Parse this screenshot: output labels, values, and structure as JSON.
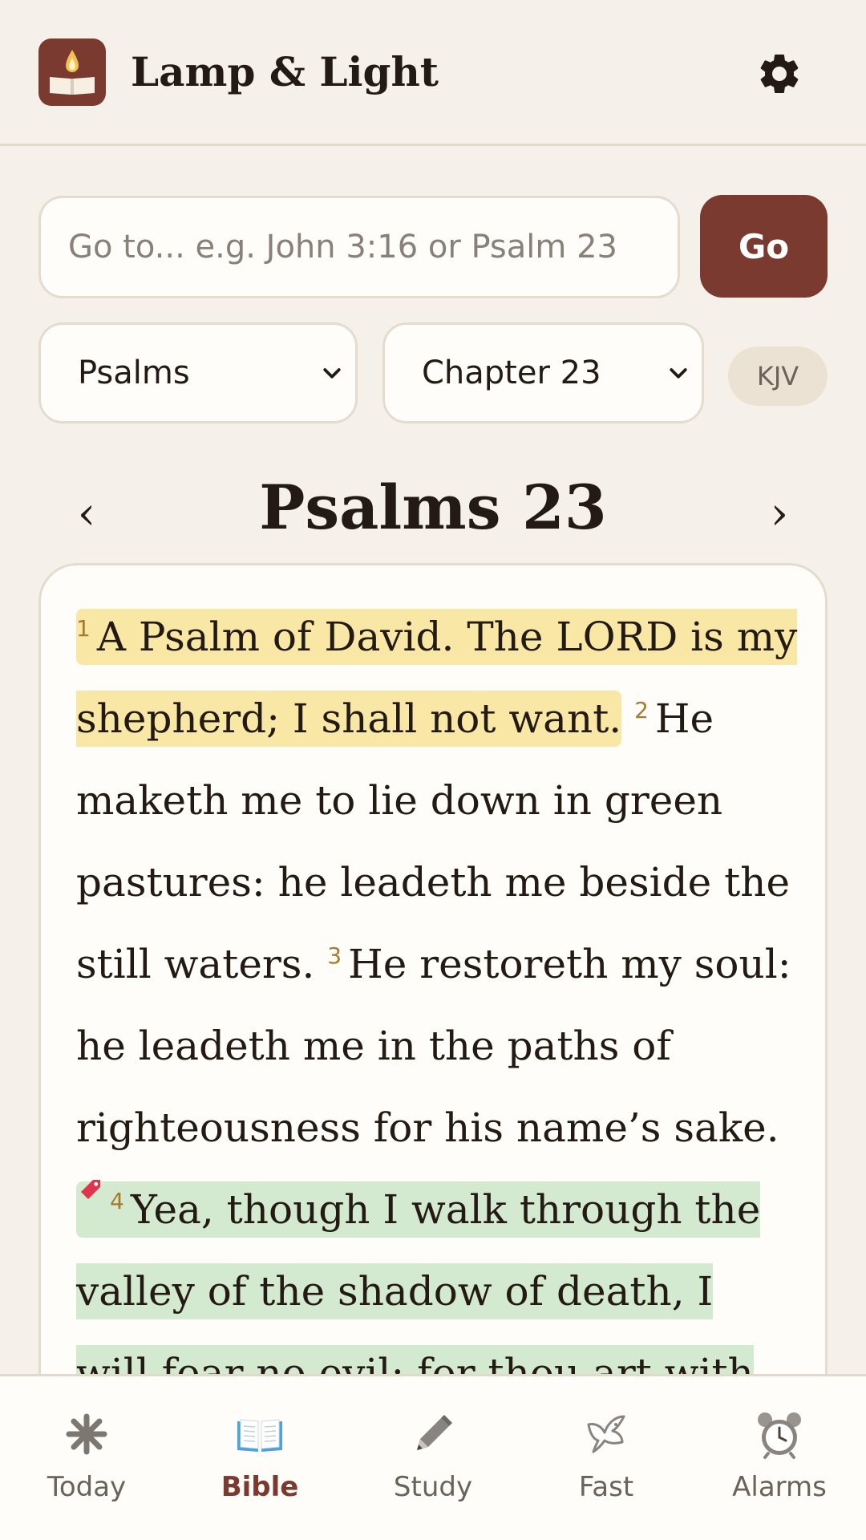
{
  "header": {
    "title": "Lamp & Light",
    "logo_icon": "lamp-book-icon",
    "settings_icon": "gear-icon"
  },
  "search": {
    "placeholder": "Go to... e.g. John 3:16 or Psalm 23",
    "value": "",
    "go_label": "Go"
  },
  "selectors": {
    "book": "Psalms",
    "chapter": "Chapter 23",
    "version": "KJV"
  },
  "chapter": {
    "title": "Psalms 23",
    "prev_icon": "chevron-left-icon",
    "next_icon": "chevron-right-icon",
    "prev_label": "‹",
    "next_label": "›"
  },
  "verses": [
    {
      "num": "1",
      "text": "A Psalm of David. The LORD is my shepherd; I shall not want.",
      "highlight": "yellow",
      "bookmarked": false
    },
    {
      "num": "2",
      "text": "He maketh me to lie down in green pastures: he leadeth me beside the still waters.",
      "highlight": null,
      "bookmarked": false
    },
    {
      "num": "3",
      "text": "He restoreth my soul: he leadeth me in the paths of righteousness for his name’s sake.",
      "highlight": null,
      "bookmarked": false
    },
    {
      "num": "4",
      "text": "Yea, though I walk through the valley of the shadow of death, I will fear no evil: for thou art with me",
      "highlight": "green",
      "bookmarked": true
    }
  ],
  "colors": {
    "accent": "#7a3a2f",
    "background": "#f5f1ea",
    "highlight_yellow": "#f9e7a6",
    "highlight_green": "#d3ead0",
    "verse_number": "#a87b2a"
  },
  "tabs": [
    {
      "label": "Today",
      "icon": "sun-icon",
      "active": false
    },
    {
      "label": "Bible",
      "icon": "open-book-icon",
      "active": true
    },
    {
      "label": "Study",
      "icon": "pencil-icon",
      "active": false
    },
    {
      "label": "Fast",
      "icon": "dove-icon",
      "active": false
    },
    {
      "label": "Alarms",
      "icon": "alarm-clock-icon",
      "active": false
    }
  ]
}
